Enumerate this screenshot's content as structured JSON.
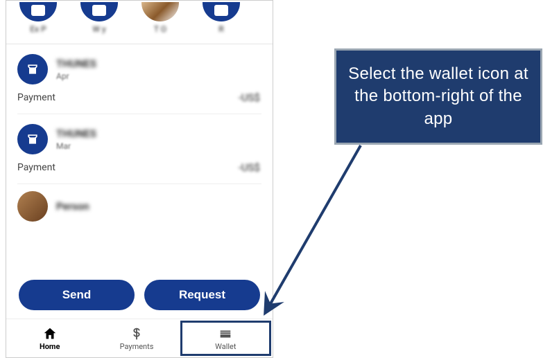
{
  "contacts": [
    {
      "label": "Ex\nP"
    },
    {
      "label": "W\ny"
    },
    {
      "label": "T\nO"
    },
    {
      "label": "\nR"
    }
  ],
  "transactions": [
    {
      "name": "THUNES",
      "date": "Apr",
      "type": "Payment",
      "amount": "-US$"
    },
    {
      "name": "THUNES",
      "date": "Mar",
      "type": "Payment",
      "amount": "-US$"
    },
    {
      "name": "Person"
    }
  ],
  "actions": {
    "send": "Send",
    "request": "Request"
  },
  "nav": {
    "home": "Home",
    "payments": "Payments",
    "wallet": "Wallet"
  },
  "callout": "Select the wallet icon at the bottom-right of the app",
  "colors": {
    "brand": "#163b8f",
    "callout_bg": "#1f3c6e",
    "callout_border": "#9aa6b2"
  }
}
